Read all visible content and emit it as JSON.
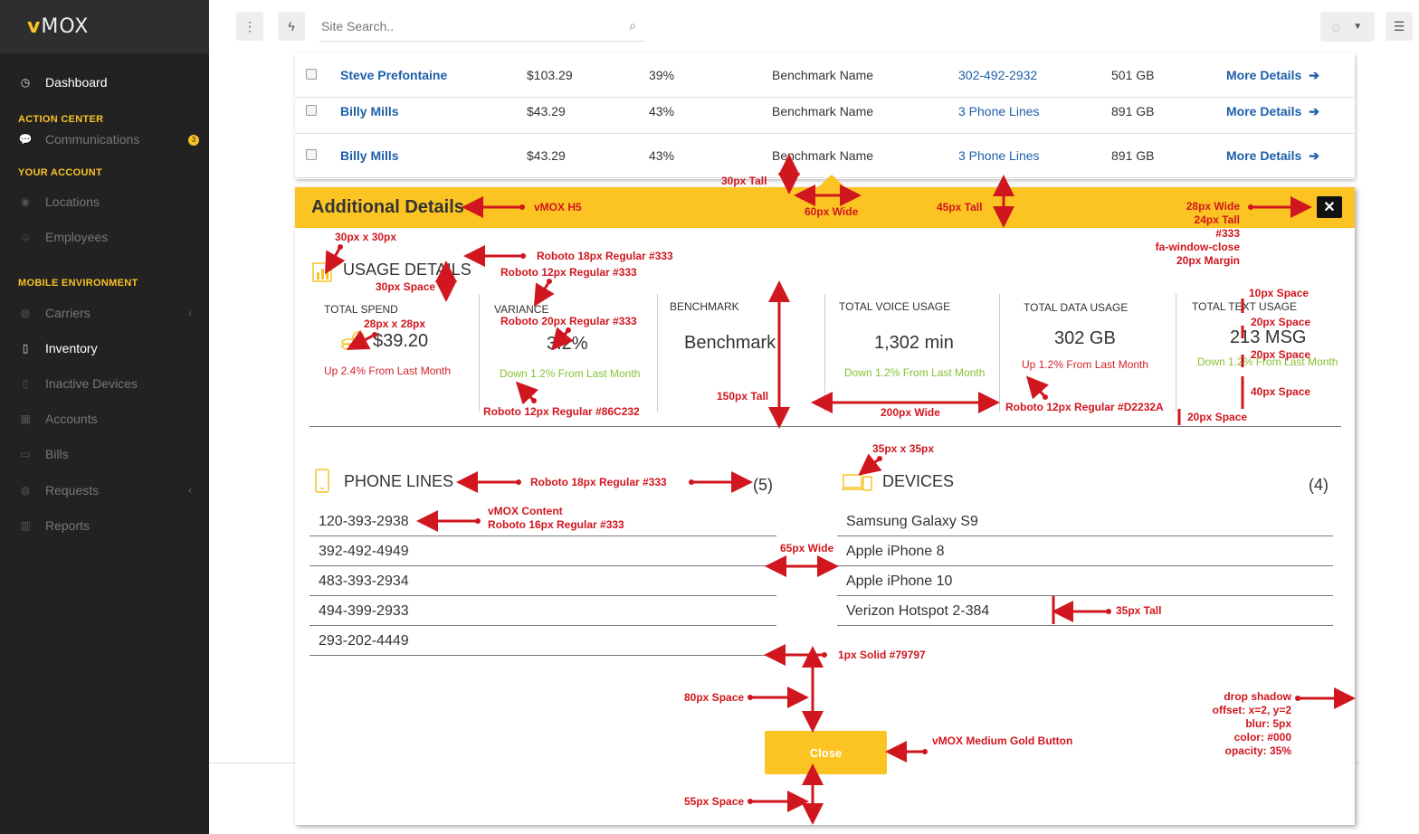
{
  "brand": {
    "logo_v": "v",
    "logo_rest": "MOX"
  },
  "sidebar": {
    "dashboard": "Dashboard",
    "action_center": "ACTION CENTER",
    "communications": "Communications",
    "communications_badge": "3",
    "your_account": "YOUR ACCOUNT",
    "locations": "Locations",
    "employees": "Employees",
    "mobile_env": "MOBILE ENVIRONMENT",
    "carriers": "Carriers",
    "inventory": "Inventory",
    "inactive_devices": "Inactive Devices",
    "accounts": "Accounts",
    "bills": "Bills",
    "requests": "Requests",
    "reports": "Reports"
  },
  "topbar": {
    "search_placeholder": "Site Search.."
  },
  "rows": [
    {
      "name": "Steve Prefontaine",
      "amount": "$103.29",
      "pct": "39%",
      "benchmark": "Benchmark Name",
      "lines": "302-492-2932",
      "data": "501 GB",
      "more": "More Details"
    },
    {
      "name": "Billy Mills",
      "amount": "$43.29",
      "pct": "43%",
      "benchmark": "Benchmark Name",
      "lines": "3 Phone Lines",
      "data": "891 GB",
      "more": "More Details"
    },
    {
      "name": "Billy Mills",
      "amount": "$43.29",
      "pct": "43%",
      "benchmark": "Benchmark Name",
      "lines": "3 Phone Lines",
      "data": "891 GB",
      "more": "More Details"
    }
  ],
  "modal": {
    "title": "Additional Details",
    "close_icon": "fa-window-close",
    "usage_title": "USAGE DETAILS",
    "stats": {
      "total_spend": {
        "label": "TOTAL SPEND",
        "value": "$39.20",
        "sub": "Up 2.4% From Last Month",
        "sub_color": "#D2232A"
      },
      "variance": {
        "label": "VARIANCE",
        "value": "3.2%",
        "sub": "Down 1.2% From Last Month",
        "sub_color": "#86C232"
      },
      "benchmark": {
        "label": "BENCHMARK",
        "value": "Benchmark"
      },
      "voice": {
        "label": "TOTAL VOICE USAGE",
        "value": "1,302 min",
        "sub": "Down 1.2% From Last Month",
        "sub_color": "#86C232"
      },
      "data": {
        "label": "TOTAL DATA USAGE",
        "value": "302 GB",
        "sub": "Up 1.2% From Last Month",
        "sub_color": "#D2232A"
      },
      "text": {
        "label": "TOTAL TEXT USAGE",
        "value": "213 MSG",
        "sub": "Down 1.2% From Last Month",
        "sub_color": "#86C232"
      }
    },
    "phone_lines": {
      "title": "PHONE LINES",
      "count": "(5)",
      "items": [
        "120-393-2938",
        "392-492-4949",
        "483-393-2934",
        "494-399-2933",
        "293-202-4449"
      ]
    },
    "devices": {
      "title": "DEVICES",
      "count": "(4)",
      "items": [
        "Samsung Galaxy S9",
        "Apple iPhone 8",
        "Apple iPhone 10",
        "Verizon Hotspot 2-384"
      ]
    },
    "close_button": "Close"
  },
  "annotations": {
    "a1": "30px Tall",
    "a2": "60px Wide",
    "a3": "vMOX H5",
    "a4": "45px Tall",
    "a5_1": "28px Wide",
    "a5_2": "24px Tall",
    "a5_3": "#333",
    "a5_4": "fa-window-close",
    "a5_5": "20px Margin",
    "a6": "30px x 30px",
    "a7": "Roboto 18px Regular #333",
    "a8": "Roboto 12px Regular #333",
    "a9": "30px Space",
    "a10": "28px x 28px",
    "a11": "Roboto 20px Regular #333",
    "a12": "Roboto 12px Regular #86C232",
    "a13": "150px Tall",
    "a14": "200px Wide",
    "a15": "Roboto 12px Regular #D2232A",
    "a16": "10px Space",
    "a17": "20px Space",
    "a18": "20px Space",
    "a19": "40px Space",
    "a20": "20px Space",
    "a21": "35px x 35px",
    "a22": "Roboto 18px Regular #333",
    "a23_1": "vMOX Content",
    "a23_2": "Roboto 16px Regular #333",
    "a24": "65px Wide",
    "a25": "35px Tall",
    "a26": "1px Solid #79797",
    "a27": "80px Space",
    "a28": "vMOX Medium Gold Button",
    "a29": "55px Space",
    "a30_1": "drop shadow",
    "a30_2": "offset: x=2, y=2",
    "a30_3": "blur: 5px",
    "a30_4": "color: #000",
    "a30_5": "opacity: 35%"
  }
}
